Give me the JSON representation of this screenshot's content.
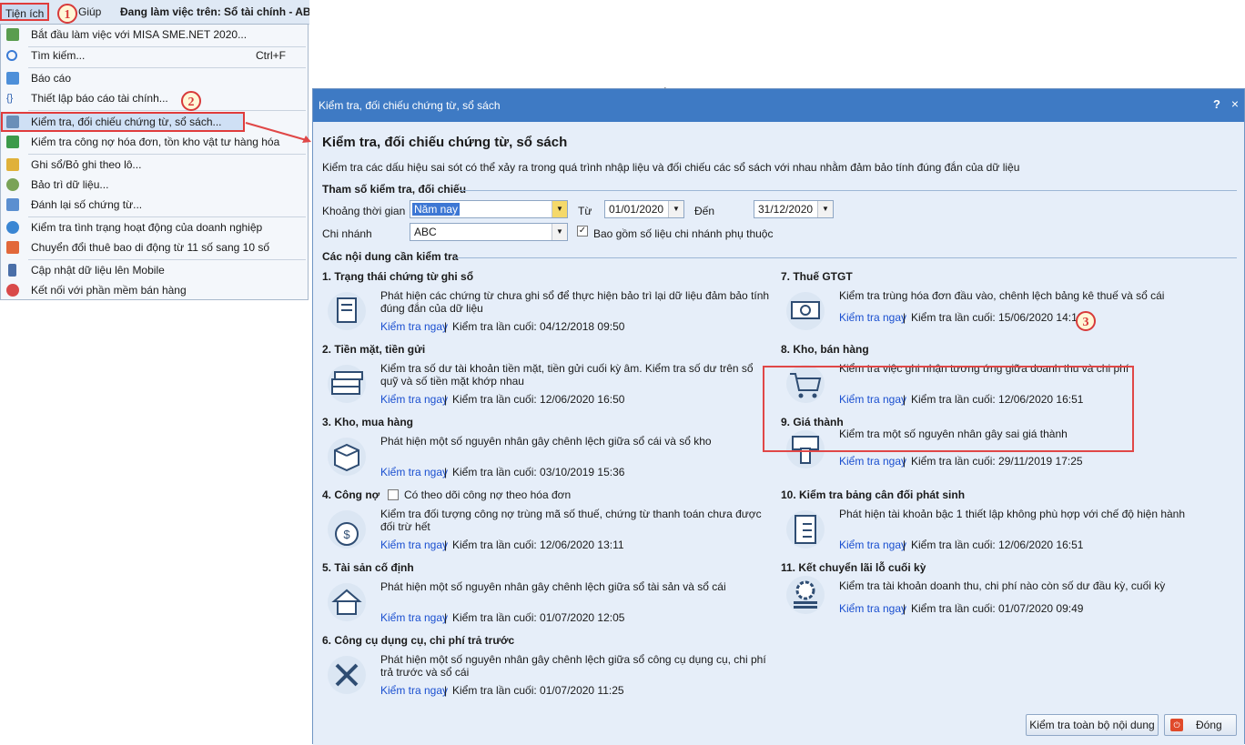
{
  "menubar": {
    "menu_tienich": "Tiện ích",
    "menu_giup": "Giúp",
    "workspace": "Đang làm việc trên: Sổ tài chính - ABC"
  },
  "menu": {
    "items": [
      {
        "label": "Bắt đầu làm việc với MISA SME.NET 2020...",
        "shortcut": "",
        "icon": "start-icon"
      },
      {
        "label": "Tìm kiếm...",
        "shortcut": "Ctrl+F",
        "icon": "search-icon"
      },
      {
        "label": "Báo cáo",
        "shortcut": "",
        "icon": "report-icon"
      },
      {
        "label": "Thiết lập báo cáo tài chính...",
        "shortcut": "",
        "icon": "formula-icon"
      },
      {
        "label": "Kiểm tra, đối chiếu chứng từ, sổ sách...",
        "shortcut": "",
        "icon": "check-document-icon"
      },
      {
        "label": "Kiểm tra công nợ hóa đơn, tồn kho vật tư hàng hóa",
        "shortcut": "",
        "icon": "check-icon"
      },
      {
        "label": "Ghi sổ/Bỏ ghi theo lô...",
        "shortcut": "",
        "icon": "batch-icon"
      },
      {
        "label": "Bảo trì dữ liệu...",
        "shortcut": "",
        "icon": "maintenance-icon"
      },
      {
        "label": "Đánh lại số chứng từ...",
        "shortcut": "",
        "icon": "renumber-icon"
      },
      {
        "label": "Kiểm tra tình trạng hoạt động của doanh nghiệp",
        "shortcut": "",
        "icon": "business-status-icon"
      },
      {
        "label": "Chuyển đổi thuê bao di động từ 11 số sang 10 số",
        "shortcut": "",
        "icon": "phone-convert-icon"
      },
      {
        "label": "Cập nhật dữ liệu lên Mobile",
        "shortcut": "",
        "icon": "mobile-icon"
      },
      {
        "label": "Kết nối với phần mềm bán hàng",
        "shortcut": "",
        "icon": "connect-icon"
      }
    ]
  },
  "callouts": {
    "c1": "1",
    "c2": "2",
    "c3": "3"
  },
  "dialog": {
    "title": "Kiểm tra, đối chiếu chứng từ, sổ sách",
    "help": "?",
    "close": "×",
    "heading": "Kiểm tra, đối chiếu chứng từ, sổ sách",
    "description": "Kiểm tra các dấu hiệu sai sót có thể xảy ra trong quá trình nhập liệu và đối chiếu các sổ sách với nhau nhằm đảm bảo tính đúng đắn của dữ liệu",
    "params_title": "Tham số kiểm tra, đối chiếu",
    "period_label": "Khoảng thời gian",
    "period_value": "Năm nay",
    "from_label": "Từ",
    "from_value": "01/01/2020",
    "to_label": "Đến",
    "to_value": "31/12/2020",
    "branch_label": "Chi nhánh",
    "branch_value": "ABC",
    "include_sub_label": "Bao gồm số liệu chi nhánh phụ thuộc",
    "include_sub_checked": true,
    "contents_title": "Các nội dung cần kiểm tra",
    "run_label": "Kiểm tra ngay",
    "sep": "|",
    "items_left": [
      {
        "title": "1. Trạng thái chứng từ ghi sổ",
        "desc": "Phát hiện các chứng từ chưa ghi sổ để thực hiện bảo trì lại dữ liệu đảm bảo tính đúng đắn của dữ liệu",
        "last": "Kiểm tra lần cuối: 04/12/2018 09:50",
        "icon": "document-feather-icon"
      },
      {
        "title": "2. Tiền mặt, tiền gửi",
        "desc": "Kiểm tra số dư tài khoản tiền mặt, tiền gửi cuối kỳ âm. Kiểm tra số dư trên sổ quỹ và số tiền mặt khớp nhau",
        "last": "Kiểm tra lần cuối: 12/06/2020 16:50",
        "icon": "cash-stack-icon"
      },
      {
        "title": "3. Kho, mua hàng",
        "desc": "Phát hiện một số nguyên nhân gây chênh lệch giữa sổ cái và sổ kho",
        "last": "Kiểm tra lần cuối: 03/10/2019 15:36",
        "icon": "box-icon"
      },
      {
        "title": "4. Công nợ",
        "desc": "Kiểm tra đối tượng công nợ trùng mã số thuế, chứng từ thanh toán chưa được đối trừ hết",
        "last": "Kiểm tra lần cuối: 12/06/2020 13:11",
        "icon": "money-bag-icon",
        "option": "Có theo dõi công nợ theo hóa đơn"
      },
      {
        "title": "5. Tài sản cố định",
        "desc": "Phát hiện một số nguyên nhân gây chênh lệch giữa sổ tài sản và sổ cái",
        "last": "Kiểm tra lần cuối: 01/07/2020 12:05",
        "icon": "house-icon"
      },
      {
        "title": "6. Công cụ dụng cụ, chi phí trả trước",
        "desc": "Phát hiện một số nguyên nhân gây chênh lệch giữa sổ công cụ dụng cụ, chi phí trả trước và sổ cái",
        "last": "Kiểm tra lần cuối: 01/07/2020 11:25",
        "icon": "tools-icon"
      }
    ],
    "items_right": [
      {
        "title": "7. Thuế GTGT",
        "desc": "Kiểm tra trùng hóa đơn đầu vào, chênh lệch bảng kê thuế và sổ cái",
        "last": "Kiểm tra lần cuối: 15/06/2020 14:12",
        "icon": "tax-bill-icon"
      },
      {
        "title": "8. Kho, bán hàng",
        "desc": "Kiểm tra việc ghi nhận tương ứng giữa doanh thu và chi phí",
        "last": "Kiểm tra lần cuối: 12/06/2020 16:51",
        "icon": "cart-icon"
      },
      {
        "title": "9. Giá thành",
        "desc": "Kiểm tra một số nguyên nhân gây sai giá thành",
        "last": "Kiểm tra lần cuối: 29/11/2019 17:25",
        "icon": "hand-money-icon"
      },
      {
        "title": "10. Kiểm tra bảng cân đối phát sinh",
        "desc": "Phát hiện tài khoản bậc 1 thiết lập không phù hợp với chế độ hiện hành",
        "last": "Kiểm tra lần cuối: 12/06/2020 16:51",
        "icon": "checklist-icon"
      },
      {
        "title": "11. Kết chuyển lãi lỗ cuối kỳ",
        "desc": "Kiểm tra tài khoản doanh thu, chi phí nào còn số dư đầu kỳ, cuối kỳ",
        "last": "Kiểm tra lần cuối: 01/07/2020 09:49",
        "icon": "gear-coins-icon"
      }
    ],
    "btn_check_all": "Kiểm tra toàn bộ nội dung",
    "btn_close": "Đóng"
  },
  "colors": {
    "accent": "#3e7ac4",
    "link": "#1a4fd0",
    "highlight": "#e03c3c"
  }
}
